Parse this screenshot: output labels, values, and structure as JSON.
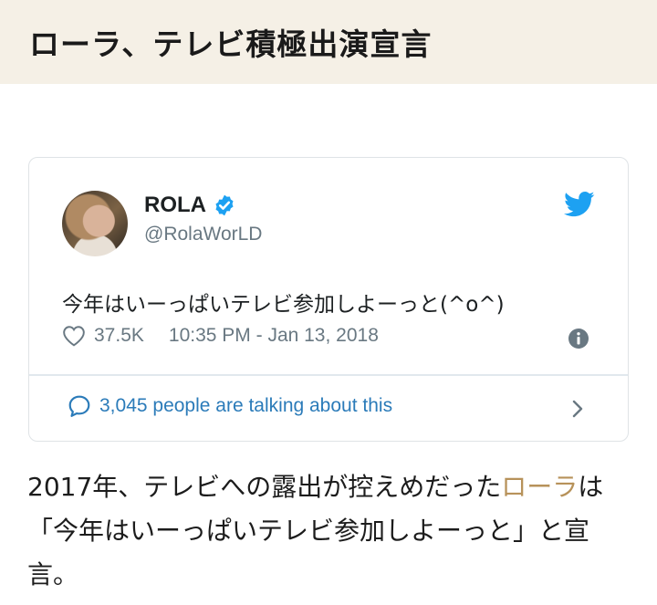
{
  "header": {
    "title": "ローラ、テレビ積極出演宣言"
  },
  "tweet": {
    "name": "ROLA",
    "handle": "@RolaWorLD",
    "text": "今年はいーっぱいテレビ参加しよーっと(^o^)",
    "likes": "37.5K",
    "timestamp": "10:35 PM - Jan 13, 2018",
    "talking": "3,045 people are talking about this"
  },
  "article": {
    "part1": "2017年、テレビへの露出が控えめだった",
    "highlight": "ローラ",
    "part2": "は「今年はいーっぱいテレビ参加しよーっと」と宣言。"
  },
  "colors": {
    "header_bg": "#f5f0e6",
    "twitter_blue": "#1da1f2",
    "link_blue": "#2b7bb9",
    "meta_gray": "#697882",
    "highlight": "#b7925a"
  },
  "icons": [
    "verified-icon",
    "twitter-bird-icon",
    "heart-icon",
    "info-icon",
    "speech-bubble-icon",
    "chevron-right-icon"
  ]
}
